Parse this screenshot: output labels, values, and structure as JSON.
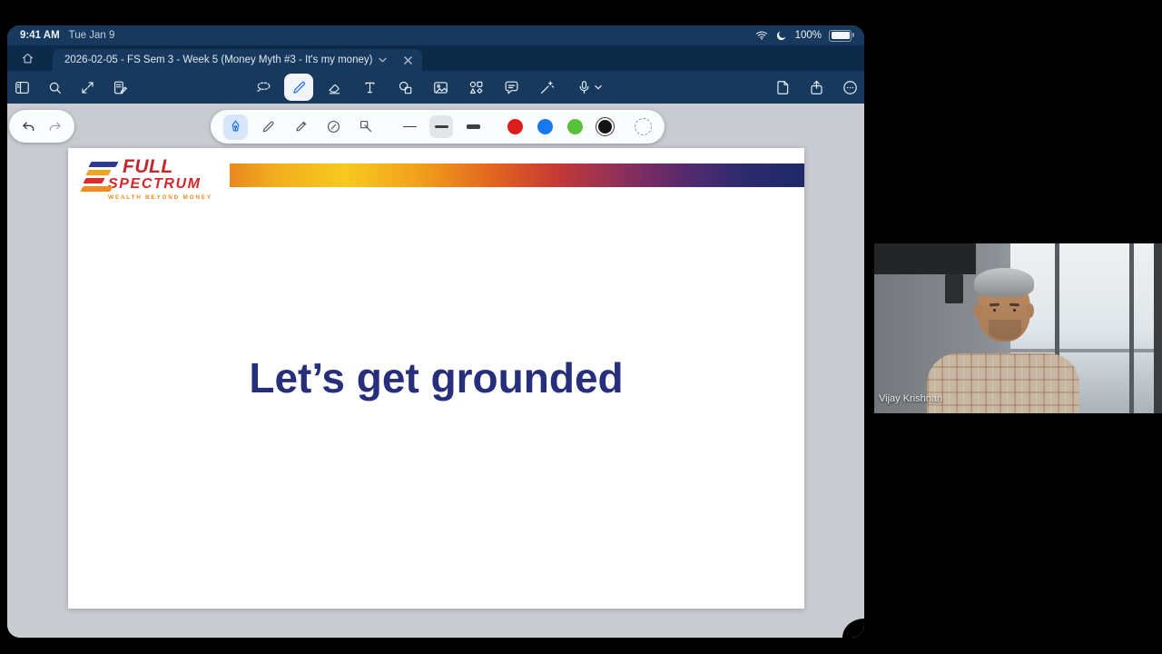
{
  "status_bar": {
    "time": "9:41 AM",
    "date": "Tue Jan 9",
    "battery_percent": "100%",
    "icons": [
      "wifi-icon",
      "moon-focus-icon",
      "battery-icon"
    ]
  },
  "tab_bar": {
    "document_title": "2026-02-05 - FS Sem 3 - Week 5 (Money Myth #3 - It's my money)",
    "icons": [
      "home-icon",
      "chevron-down-icon",
      "tab-close-icon"
    ]
  },
  "toolbar": {
    "left_icons": [
      "sidebar-thumbnails-icon",
      "search-icon",
      "expand-arrows-icon",
      "quick-note-icon"
    ],
    "center_tools": [
      "lasso-tool",
      "pen-tool",
      "eraser-tool",
      "text-tool",
      "shapes-tool",
      "image-tool",
      "elements-tool",
      "comment-tool",
      "pointer-tool",
      "record-audio"
    ],
    "selected_tool": "pen-tool",
    "right_icons": [
      "add-page-icon",
      "share-icon",
      "more-icon"
    ]
  },
  "pen_toolbar": {
    "history_buttons": [
      "undo",
      "redo"
    ],
    "pens": [
      "fountain-pen",
      "ballpoint-pen",
      "brush-pen",
      "shape-pen",
      "fill-pen"
    ],
    "selected_pen": "fountain-pen",
    "thicknesses": [
      "thin",
      "medium",
      "thick"
    ],
    "selected_thickness": "medium",
    "colors": [
      "#de1c1c",
      "#1878f0",
      "#57c13a",
      "#141414"
    ],
    "selected_color": "#141414",
    "custom_color_button": "custom-color-picker"
  },
  "slide": {
    "title": "Let’s get grounded",
    "logo": {
      "word1": "FULL",
      "word2": "SPECTRUM",
      "tagline": "WEALTH BEYOND MONEY"
    },
    "banner_gradient": [
      "#e9881f",
      "#f7c91e",
      "#e2641f",
      "#8e2f5a",
      "#1d2a67"
    ]
  },
  "video_call": {
    "participant_name": "Vijay Krishnan"
  },
  "colors": {
    "toolbar_navy": "#17395d",
    "tab_row_navy": "#0d2a49",
    "canvas_gray": "#c8ccd1",
    "slide_title": "#272f7c",
    "accent_blue": "#1a6ef5",
    "logo_red": "#c1272d",
    "logo_orange": "#ef8b1c"
  }
}
